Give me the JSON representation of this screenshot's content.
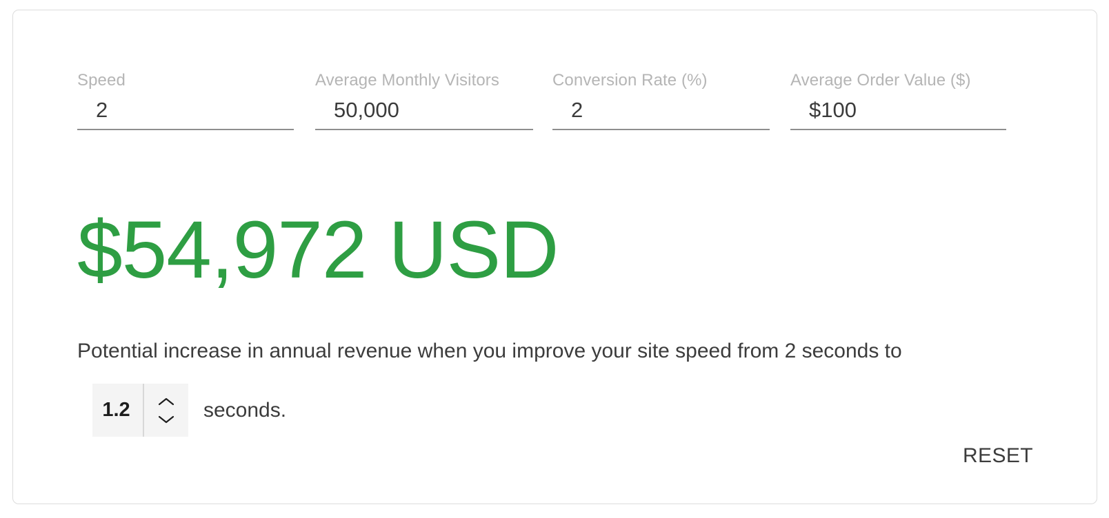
{
  "card": {
    "accent_color": "#2e9e43",
    "border_color": "#dcdcdc",
    "background_color": "#ffffff"
  },
  "inputs": [
    {
      "label": "Speed",
      "value": "2",
      "placeholder": "Speed",
      "name": "speed"
    },
    {
      "label": "Average Monthly Visitors",
      "value": "50,000",
      "placeholder": "Average Monthly Visitors",
      "name": "monthly-visitors"
    },
    {
      "label": "Conversion Rate (%)",
      "value": "2",
      "placeholder": "Conversion Rate (%)",
      "name": "conversion-rate"
    },
    {
      "label": "Average Order Value ($)",
      "value": "$100",
      "placeholder": "Average Order Value ($)",
      "name": "average-order-value"
    }
  ],
  "result": {
    "amount": "$54,972 USD",
    "description": "Potential increase in annual revenue when you improve your site speed from 2 seconds to",
    "unit_label": "seconds."
  },
  "stepper": {
    "value": "1.2",
    "increment_icon": "chevron-up-icon",
    "decrement_icon": "chevron-down-icon"
  },
  "actions": {
    "reset_label": "RESET"
  }
}
